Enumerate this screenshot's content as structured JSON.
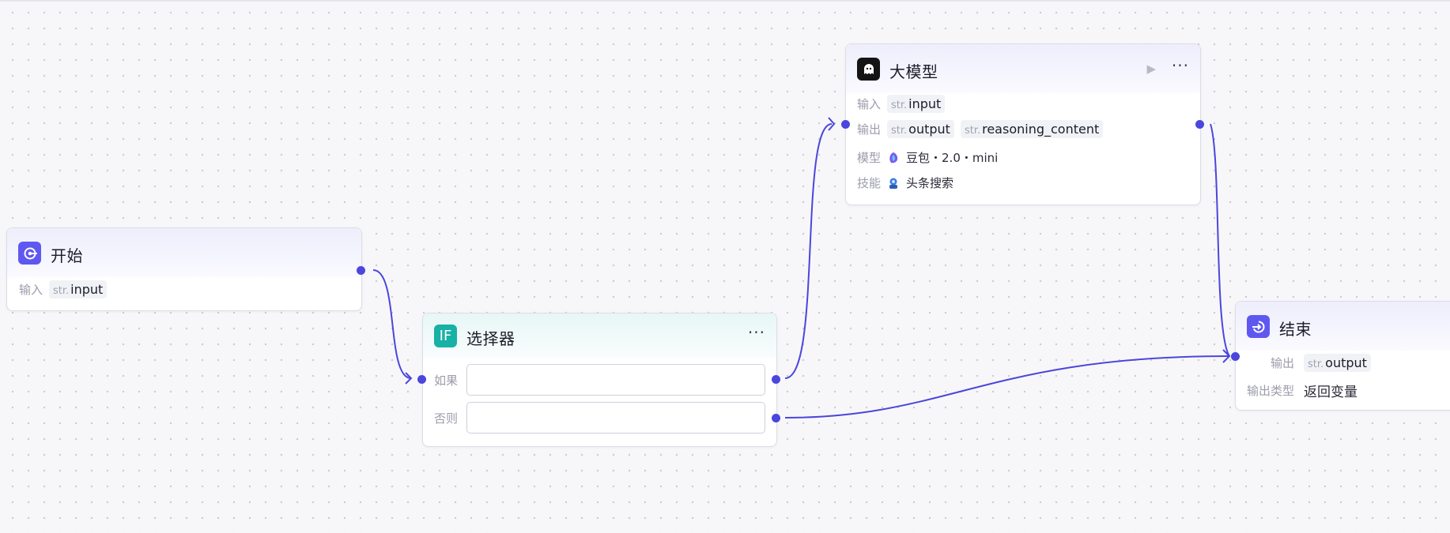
{
  "colors": {
    "edge": "#4b46dd",
    "start_icon": "#5f58f0",
    "selector_icon": "#17b1a6",
    "llm_icon": "#141414",
    "end_icon": "#5f58f0"
  },
  "start_node": {
    "title": "开始",
    "icon": "start-circle-icon",
    "input_label": "输入",
    "input_type": "str.",
    "input_name": "input"
  },
  "selector_node": {
    "title": "选择器",
    "icon_text": "IF",
    "more_label": "···",
    "if_label": "如果",
    "else_label": "否则",
    "if_value": "",
    "else_value": ""
  },
  "llm_node": {
    "title": "大模型",
    "icon": "ghost-icon",
    "run_label": "▶",
    "more_label": "···",
    "input_label": "输入",
    "input_type": "str.",
    "input_name": "input",
    "output_label": "输出",
    "outputs": [
      {
        "type": "str.",
        "name": "output"
      },
      {
        "type": "str.",
        "name": "reasoning_content"
      }
    ],
    "model_label": "模型",
    "model_value": "豆包・2.0・mini",
    "skill_label": "技能",
    "skill_value": "头条搜索"
  },
  "end_node": {
    "title": "结束",
    "icon": "end-arrow-icon",
    "output_label": "输出",
    "output_type": "str.",
    "output_name": "output",
    "output_kind_label": "输出类型",
    "output_kind_value": "返回变量"
  }
}
